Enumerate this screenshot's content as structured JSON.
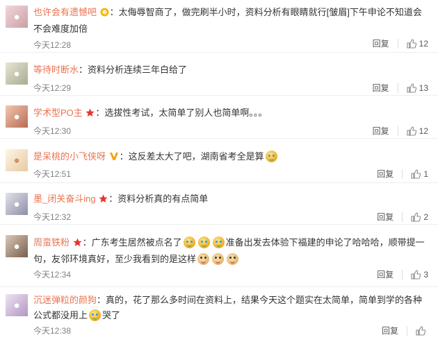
{
  "comments": [
    {
      "user": "也许会有遗憾吧",
      "badge": "yellow-medal-icon",
      "segments": [
        "：太侮辱智商了，做完刷半小时，资料分析有眼睛就行[皱眉]下午申论不知道会不会难度加倍"
      ],
      "time": "今天12:28",
      "reply": "回复",
      "likes": "12"
    },
    {
      "user": "等待时断水",
      "segments": [
        "：资料分析连续三年白给了"
      ],
      "time": "今天12:29",
      "reply": "回复",
      "likes": "13"
    },
    {
      "user": "学术型PO主",
      "badge": "red-star-icon",
      "segments": [
        "：选拔性考试，太简单了别人也简单啊。。。"
      ],
      "time": "今天12:30",
      "reply": "回复",
      "likes": "12"
    },
    {
      "user": "是呆桃的小飞侠呀",
      "badge": "orange-v-icon",
      "segments": [
        "：这反差太大了吧，湖南省考全是算"
      ],
      "time": "今天12:51",
      "reply": "回复",
      "likes": "1"
    },
    {
      "user": "墨_闭关奋斗ing",
      "badge": "red-star-icon",
      "segments": [
        "：资料分析真的有点简单"
      ],
      "time": "今天12:32",
      "reply": "回复",
      "likes": "2"
    },
    {
      "user": "周蛮铁粉",
      "badge": "red-star-icon",
      "segments": [
        "：广东考生居然被点名了",
        "准备出发去体验下福建的申论了哈哈哈，顺带提一句，友邻环境真好，至少我看到的是这样"
      ],
      "time": "今天12:34",
      "reply": "回复",
      "likes": "3"
    },
    {
      "user": "沉迷弹粒的颜狗",
      "segments": [
        "：真的，花了那么多时间在资料上，结果今天这个题实在太简单，简单到学的各种公式都没用上",
        "哭了"
      ],
      "time": "今天12:38",
      "reply": "回复",
      "likes": ""
    }
  ]
}
